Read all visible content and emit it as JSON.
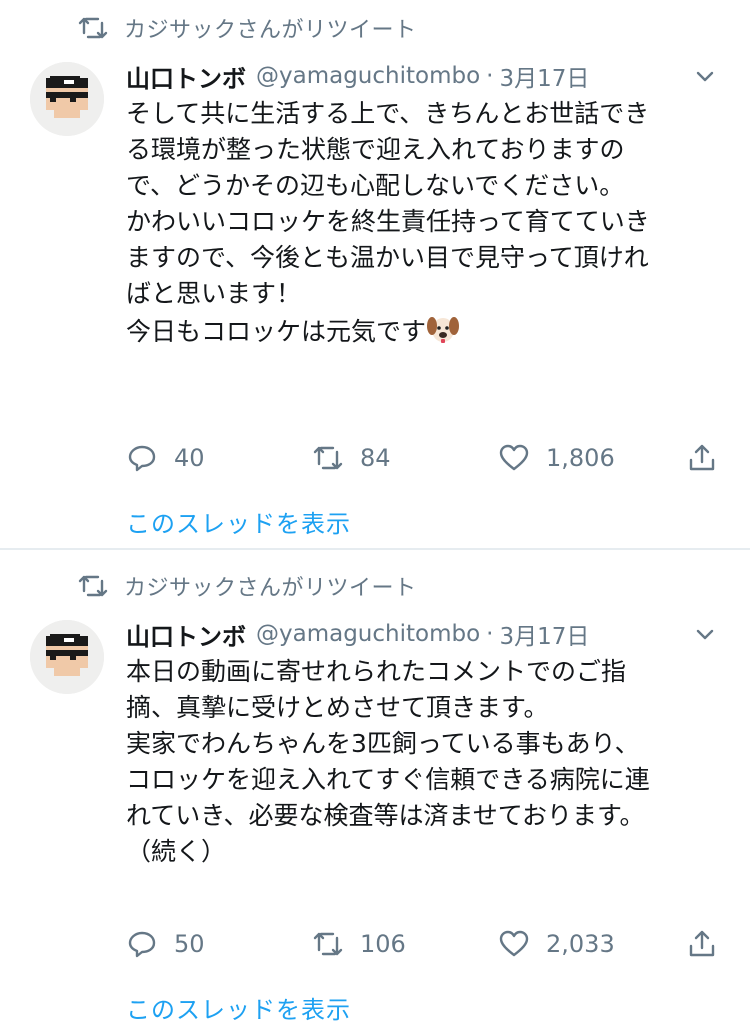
{
  "tweets": [
    {
      "retweet_label": "カジサックさんがリツイート",
      "author_name": "山口トンボ",
      "handle": "@yamaguchitombo",
      "separator": "·",
      "date": "3月17日",
      "lines": [
        "そして共に生活する上で、きちんとお世話でき",
        "る環境が整った状態で迎え入れておりますの",
        "で、どうかその辺も心配しないでください。",
        "",
        "かわいいコロッケを終生責任持って育てていき",
        "ますので、今後とも温かい目で見守って頂けれ",
        "ばと思います！",
        "",
        "今日もコロッケは元気です"
      ],
      "emoji": "dog-face-icon",
      "replies": "40",
      "retweets": "84",
      "likes": "1,806",
      "thread_link": "このスレッドを表示"
    },
    {
      "retweet_label": "カジサックさんがリツイート",
      "author_name": "山口トンボ",
      "handle": "@yamaguchitombo",
      "separator": "·",
      "date": "3月17日",
      "lines": [
        "本日の動画に寄せれられたコメントでのご指",
        "摘、真摯に受けとめさせて頂きます。",
        "",
        "実家でわんちゃんを3匹飼っている事もあり、",
        "コロッケを迎え入れてすぐ信頼できる病院に連",
        "れていき、必要な検査等は済ませております。",
        "（続く）"
      ],
      "replies": "50",
      "retweets": "106",
      "likes": "2,033",
      "thread_link": "このスレッドを表示"
    }
  ],
  "colors": {
    "text": "#14171a",
    "secondary": "#657786",
    "link": "#1da1f2",
    "divider": "#e6ecf0"
  }
}
